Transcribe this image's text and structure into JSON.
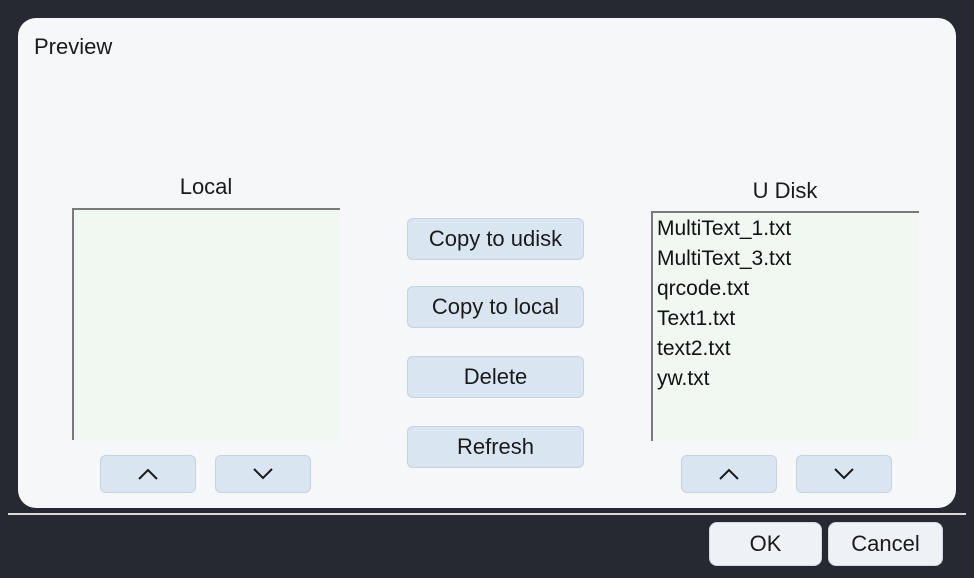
{
  "dialog": {
    "title": "Preview"
  },
  "local": {
    "label": "Local",
    "files": []
  },
  "udisk": {
    "label": "U Disk",
    "files": [
      "MultiText_1.txt",
      "MultiText_3.txt",
      "qrcode.txt",
      "Text1.txt",
      "text2.txt",
      "yw.txt"
    ]
  },
  "actions": {
    "copy_to_udisk": "Copy to udisk",
    "copy_to_local": "Copy to local",
    "delete": "Delete",
    "refresh": "Refresh"
  },
  "icons": {
    "up": "chevron-up-icon",
    "down": "chevron-down-icon"
  },
  "footer": {
    "ok": "OK",
    "cancel": "Cancel"
  },
  "colors": {
    "background": "#262932",
    "dialog": "#f5f7f8",
    "listbox": "#f1f8f1",
    "button": "#d9e6f2"
  }
}
